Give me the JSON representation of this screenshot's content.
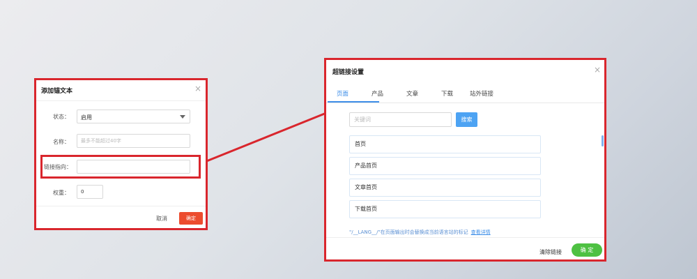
{
  "anchor_dialog": {
    "title": "添加锚文本",
    "close_symbol": "×",
    "status_label": "状态：",
    "status_value": "启用",
    "name_label": "名称：",
    "name_placeholder": "最多不能超过40字",
    "link_label": "链接指向：",
    "link_value": "",
    "weight_label": "权重：",
    "weight_value": "0",
    "cancel_label": "取消",
    "confirm_label": "确定",
    "confirm_color": "#ec4c2e"
  },
  "link_dialog": {
    "title": "超链接设置",
    "close_symbol": "×",
    "tabs": [
      {
        "label": "页面",
        "active": true
      },
      {
        "label": "产品",
        "active": false
      },
      {
        "label": "文章",
        "active": false
      },
      {
        "label": "下载",
        "active": false
      },
      {
        "label": "站外链接",
        "active": false
      }
    ],
    "keyword_placeholder": "关键词",
    "search_label": "搜索",
    "pages": [
      "首页",
      "产品首页",
      "文章首页",
      "下载首页"
    ],
    "hint_text": "\"/__LANG__/\"在页面输出时会替换成当前语言站的标记",
    "hint_link": "查看详情",
    "clear_label": "清除链接",
    "confirm_label": "确 定",
    "accent_color": "#3d8ee8",
    "confirm_color": "#4ec142"
  },
  "highlight_color": "#d9262d"
}
